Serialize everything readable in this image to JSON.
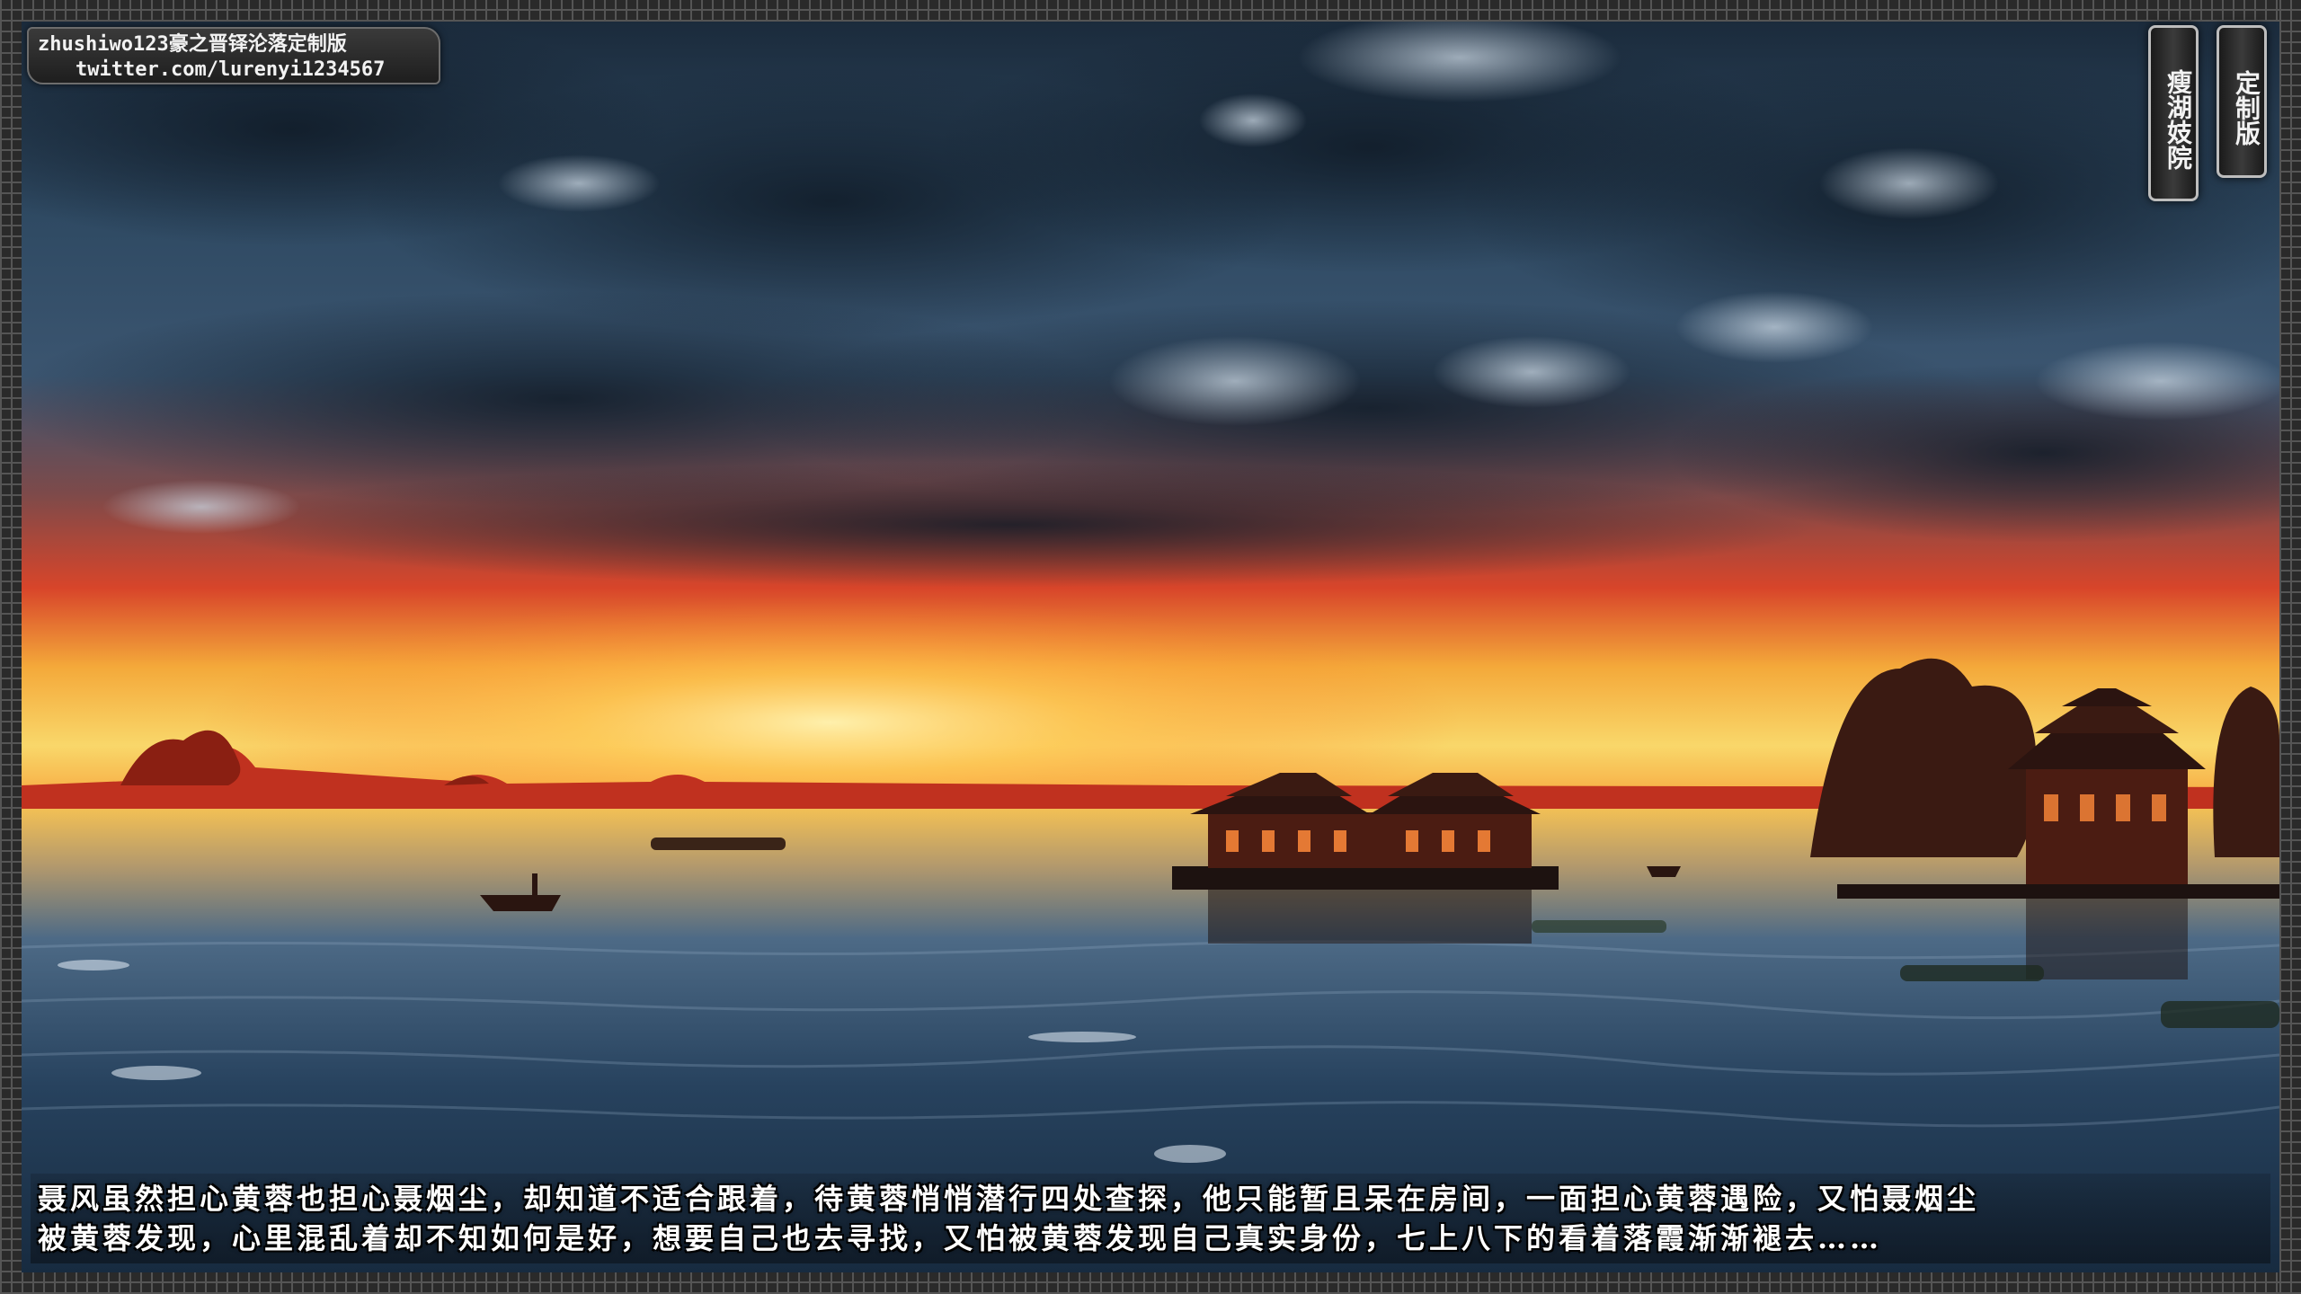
{
  "watermark": {
    "line1": "zhushiwo123豪之晋铎沦落定制版",
    "line2": "twitter.com/lurenyi1234567"
  },
  "seals": {
    "left": "瘦湖妓院",
    "right": "定制版"
  },
  "subtitle": {
    "line1": "聂风虽然担心黄蓉也担心聂烟尘，却知道不适合跟着，待黄蓉悄悄潜行四处查探，他只能暂且呆在房间，一面担心黄蓉遇险，又怕聂烟尘",
    "line2": "被黄蓉发现，心里混乱着却不知如何是好，想要自己也去寻找，又怕被黄蓉发现自己真实身份，七上八下的看着落霞渐渐褪去……"
  },
  "colors": {
    "sky_top": "#1f3448",
    "sky_mid": "#3e5872",
    "sunset_red": "#d8452a",
    "sunset_gold": "#f7c04a",
    "water": "#27425e"
  }
}
